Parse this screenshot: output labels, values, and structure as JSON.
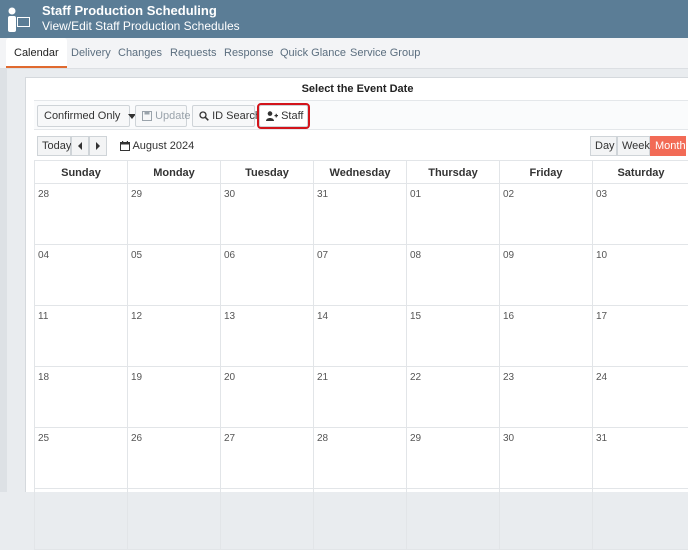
{
  "header": {
    "title": "Staff Production Scheduling",
    "subtitle": "View/Edit Staff Production Schedules",
    "logo_icon": "staff-logo-icon"
  },
  "tabs": [
    {
      "label": "Calendar",
      "active": true
    },
    {
      "label": "Delivery"
    },
    {
      "label": "Changes"
    },
    {
      "label": "Requests"
    },
    {
      "label": "Response"
    },
    {
      "label": "Quick Glance"
    },
    {
      "label": "Service Group"
    }
  ],
  "panel": {
    "title": "Select the Event Date"
  },
  "toolbar": {
    "filter_selected": "Confirmed Only",
    "update_label": "Update",
    "id_search_label": "ID Search",
    "staff_label": "Staff"
  },
  "nav": {
    "today_label": "Today",
    "prev_icon": "chevron-left-icon",
    "next_icon": "chevron-right-icon",
    "month_label": "August 2024",
    "views": [
      "Day",
      "Week",
      "Month"
    ],
    "active_view": "Month"
  },
  "calendar": {
    "weekdays": [
      "Sunday",
      "Monday",
      "Tuesday",
      "Wednesday",
      "Thursday",
      "Friday",
      "Saturday"
    ],
    "weeks": [
      [
        "28",
        "29",
        "30",
        "31",
        "01",
        "02",
        "03"
      ],
      [
        "04",
        "05",
        "06",
        "07",
        "08",
        "09",
        "10"
      ],
      [
        "11",
        "12",
        "13",
        "14",
        "15",
        "16",
        "17"
      ],
      [
        "18",
        "19",
        "20",
        "21",
        "22",
        "23",
        "24"
      ],
      [
        "25",
        "26",
        "27",
        "28",
        "29",
        "30",
        "31"
      ],
      [
        "",
        "",
        "",
        "",
        "",
        "",
        ""
      ]
    ]
  },
  "colors": {
    "header_bg": "#5b7d96",
    "active_tab_underline": "#e06a2f",
    "month_active": "#f26b56",
    "highlight_box": "#d3141b"
  }
}
